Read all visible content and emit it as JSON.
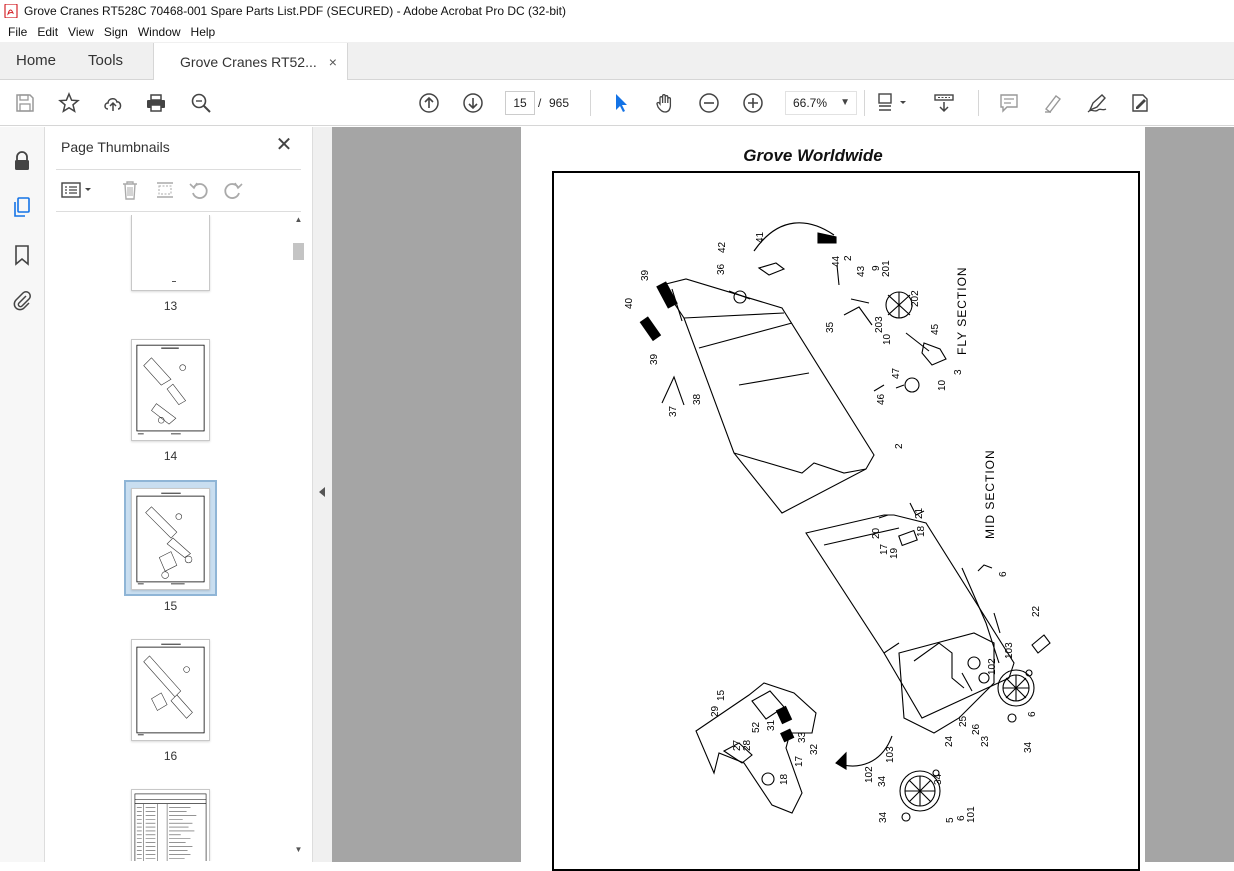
{
  "window": {
    "title": "Grove Cranes RT528C 70468-001 Spare Parts List.PDF (SECURED) - Adobe Acrobat Pro DC (32-bit)"
  },
  "menu": [
    "File",
    "Edit",
    "View",
    "Sign",
    "Window",
    "Help"
  ],
  "tabs": {
    "home": "Home",
    "tools": "Tools",
    "document": "Grove Cranes RT52...",
    "close": "×"
  },
  "toolbar": {
    "current_page": "15",
    "page_separator": "/",
    "total_pages": "965",
    "zoom": "66.7%"
  },
  "panel": {
    "title": "Page Thumbnails",
    "close": "✕",
    "thumbnails": [
      {
        "label": "13"
      },
      {
        "label": "14"
      },
      {
        "label": "15",
        "selected": true
      },
      {
        "label": "16"
      }
    ]
  },
  "document": {
    "header": "Grove Worldwide",
    "section_labels": {
      "fly": "FLY SECTION",
      "mid": "MID SECTION"
    },
    "callouts": [
      "42",
      "41",
      "36",
      "44",
      "43",
      "2",
      "9",
      "201",
      "202",
      "40",
      "39",
      "39",
      "35",
      "203",
      "10",
      "45",
      "3",
      "10",
      "47",
      "46",
      "37",
      "38",
      "2",
      "21",
      "20",
      "18",
      "17",
      "19",
      "6",
      "22",
      "15",
      "29",
      "27",
      "28",
      "52",
      "31",
      "33",
      "32",
      "103",
      "102",
      "34",
      "6",
      "17",
      "18",
      "25",
      "26",
      "23",
      "24",
      "34",
      "103",
      "102",
      "34",
      "5",
      "101",
      "6",
      "34"
    ]
  },
  "colors": {
    "doc_background": "#a5a5a5",
    "selection_fill": "#c9def0",
    "selection_border": "#8fb5d6",
    "select_tool_active": "#1473e6",
    "pdf_icon": "#d4242a"
  }
}
